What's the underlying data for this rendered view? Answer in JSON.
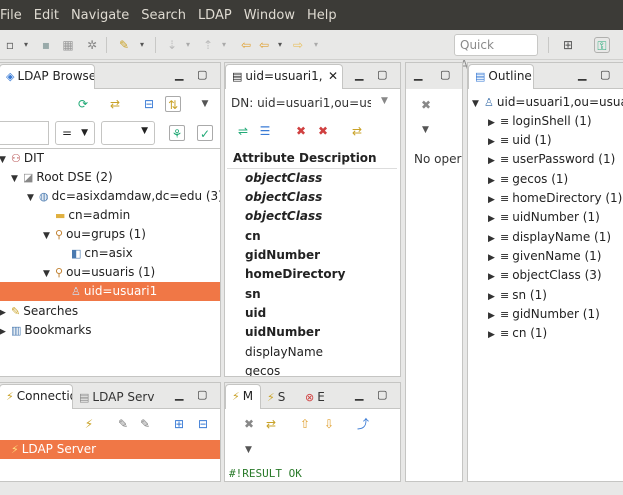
{
  "menu": [
    "File",
    "Edit",
    "Navigate",
    "Search",
    "LDAP",
    "Window",
    "Help"
  ],
  "toolbar": {
    "quick_access": "Quick Access"
  },
  "browser": {
    "tab": "LDAP Browser",
    "filter_value": "=",
    "tree": [
      {
        "label": "DIT"
      },
      {
        "label": "Root DSE (2)"
      },
      {
        "label": "dc=asixdamdaw,dc=edu (3)"
      },
      {
        "label": "cn=admin"
      },
      {
        "label": "ou=grups (1)"
      },
      {
        "label": "cn=asix"
      },
      {
        "label": "ou=usuaris (1)"
      },
      {
        "label": "uid=usuari1"
      },
      {
        "label": "Searches"
      },
      {
        "label": "Bookmarks"
      }
    ]
  },
  "editor": {
    "tab": "uid=usuari1,",
    "dn": "DN: uid=usuari1,ou=usua",
    "header": "Attribute Description",
    "attributes": [
      "objectClass",
      "objectClass",
      "objectClass",
      "cn",
      "gidNumber",
      "homeDirectory",
      "sn",
      "uid",
      "uidNumber",
      "displayName",
      "gecos"
    ]
  },
  "props": {
    "text": "No oper"
  },
  "outline": {
    "tab": "Outline",
    "root": "uid=usuari1,ou=usuar",
    "items": [
      "loginShell (1)",
      "uid (1)",
      "userPassword (1)",
      "gecos (1)",
      "homeDirectory (1)",
      "uidNumber (1)",
      "displayName (1)",
      "givenName (1)",
      "objectClass (3)",
      "sn (1)",
      "gidNumber (1)",
      "cn (1)"
    ]
  },
  "connections": {
    "tab1": "Connectio",
    "tab2": "LDAP Serv",
    "server": "LDAP Server"
  },
  "modlog": {
    "tab1": "M",
    "tab2": "S",
    "tab3": "E",
    "log": "#!RESULT OK"
  }
}
